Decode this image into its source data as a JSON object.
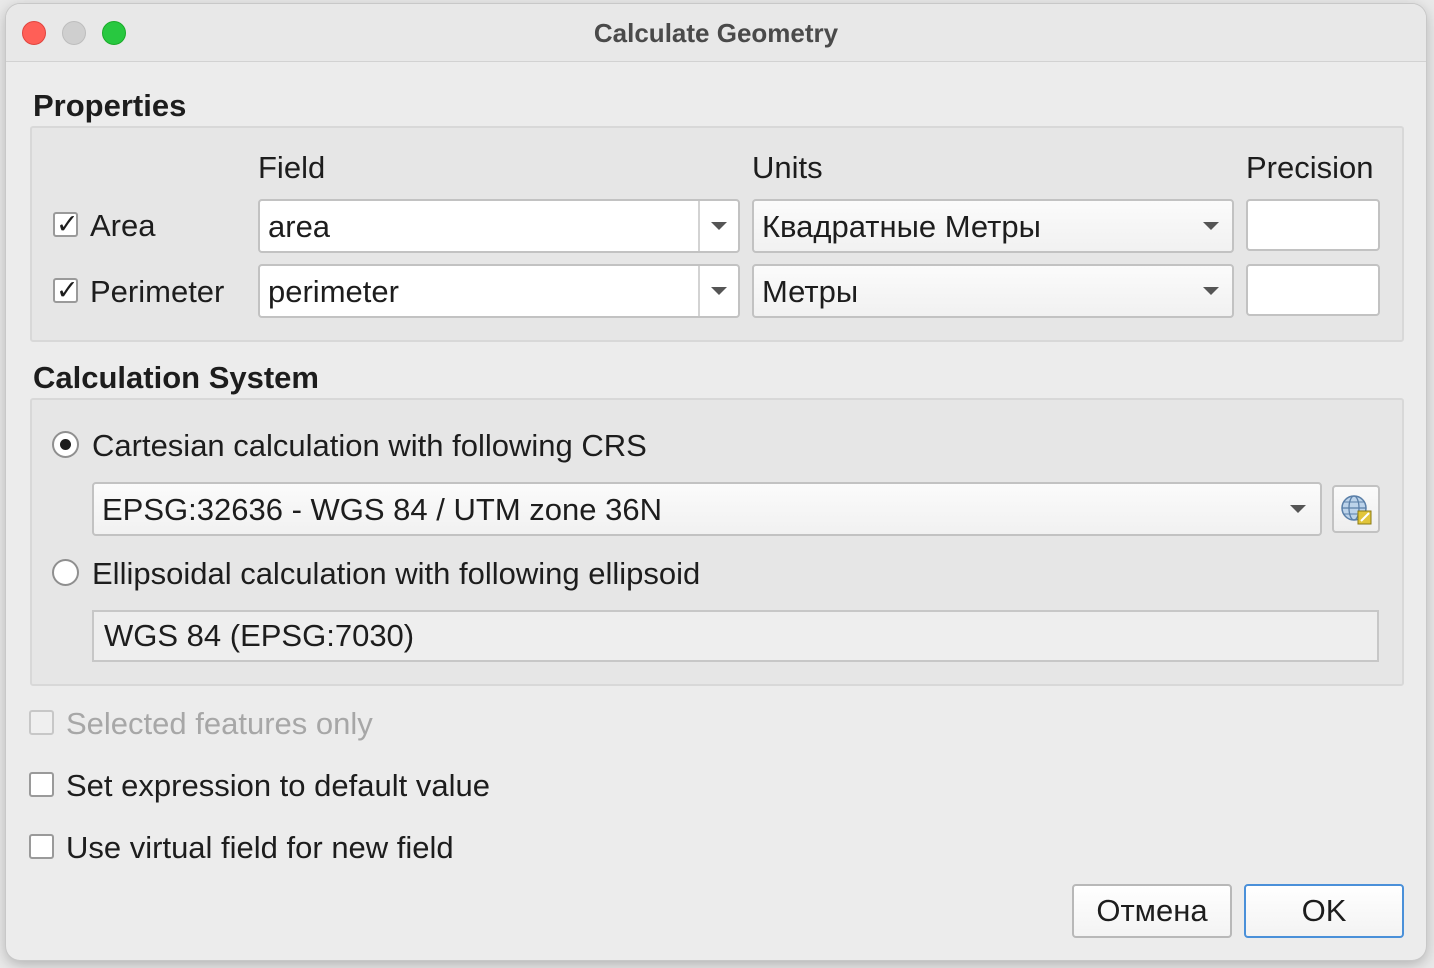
{
  "window": {
    "title": "Calculate Geometry"
  },
  "properties": {
    "title": "Properties",
    "headers": {
      "field": "Field",
      "units": "Units",
      "precision": "Precision"
    },
    "rows": [
      {
        "label": "Area",
        "checked": true,
        "field": "area",
        "units": "Квадратные Метры",
        "precision": ""
      },
      {
        "label": "Perimeter",
        "checked": true,
        "field": "perimeter",
        "units": "Метры",
        "precision": ""
      }
    ]
  },
  "calculation_system": {
    "title": "Calculation System",
    "cartesian": {
      "label": "Cartesian calculation with following CRS",
      "selected": true,
      "crs": "EPSG:32636 - WGS 84 / UTM zone 36N"
    },
    "ellipsoidal": {
      "label": "Ellipsoidal calculation with following ellipsoid",
      "selected": false,
      "ellipsoid": "WGS 84 (EPSG:7030)"
    }
  },
  "options": {
    "selected_only": {
      "label": "Selected features only",
      "checked": false,
      "enabled": false
    },
    "default_value": {
      "label": "Set expression to default value",
      "checked": false
    },
    "virtual_field": {
      "label": "Use virtual field for new field",
      "checked": false
    }
  },
  "buttons": {
    "cancel": "Отмена",
    "ok": "OK"
  },
  "colors": {
    "accent": "#4a90d9",
    "close": "#ff5f57",
    "maximize": "#28c840"
  }
}
